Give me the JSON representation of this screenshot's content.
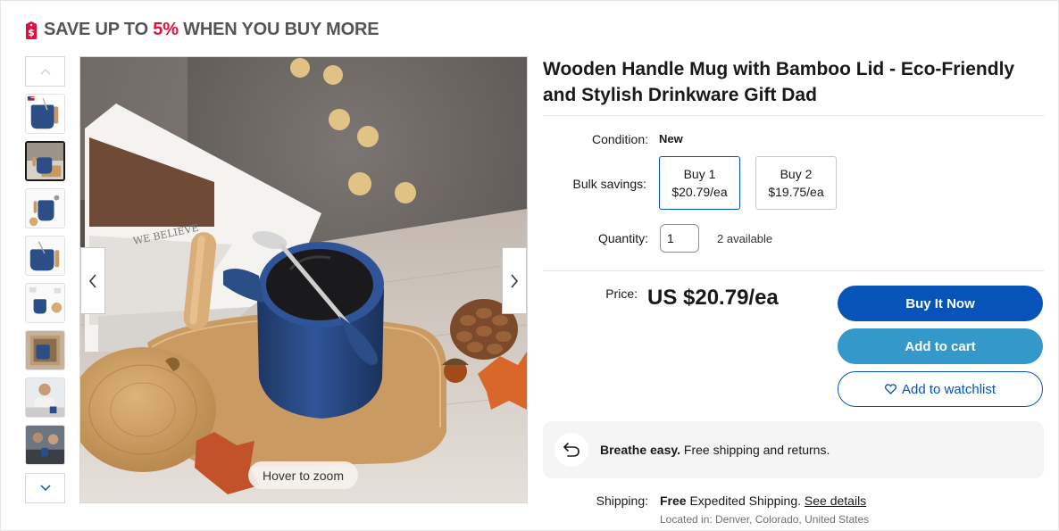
{
  "promo": {
    "prefix": "SAVE UP TO ",
    "percent": "5%",
    "suffix": " WHEN YOU BUY MORE",
    "icon": "price-tag-dollar-icon",
    "accent_color": "#e0103a"
  },
  "gallery": {
    "thumbnail_count": 8,
    "selected_index": 1,
    "zoom_hint": "Hover to zoom",
    "prev_icon": "chevron-left-icon",
    "next_icon": "chevron-right-icon",
    "up_icon": "chevron-up-icon",
    "down_icon": "chevron-down-icon"
  },
  "product": {
    "title": "Wooden Handle Mug with Bamboo Lid - Eco-Friendly and Stylish Drinkware Gift Dad",
    "condition_label": "Condition:",
    "condition_value": "New",
    "bulk_label": "Bulk savings:",
    "bulk_options": [
      {
        "qty": "Buy 1",
        "price": "$20.79/ea",
        "selected": true
      },
      {
        "qty": "Buy 2",
        "price": "$19.75/ea",
        "selected": false
      }
    ],
    "quantity_label": "Quantity:",
    "quantity_value": "1",
    "available": "2 available",
    "price_label": "Price:",
    "price": "US $20.79/ea"
  },
  "actions": {
    "buy_now": "Buy It Now",
    "add_to_cart": "Add to cart",
    "add_to_watchlist": "Add to watchlist",
    "watch_icon": "heart-icon",
    "primary_color": "#0654ba",
    "cart_color": "#3498ca"
  },
  "returns": {
    "icon": "return-arrow-icon",
    "bold": "Breathe easy.",
    "text": " Free shipping and returns."
  },
  "shipping": {
    "label": "Shipping:",
    "free": "Free",
    "method": " Expedited Shipping. ",
    "details_link": "See details",
    "located": "Located in: Denver, Colorado, United States"
  }
}
